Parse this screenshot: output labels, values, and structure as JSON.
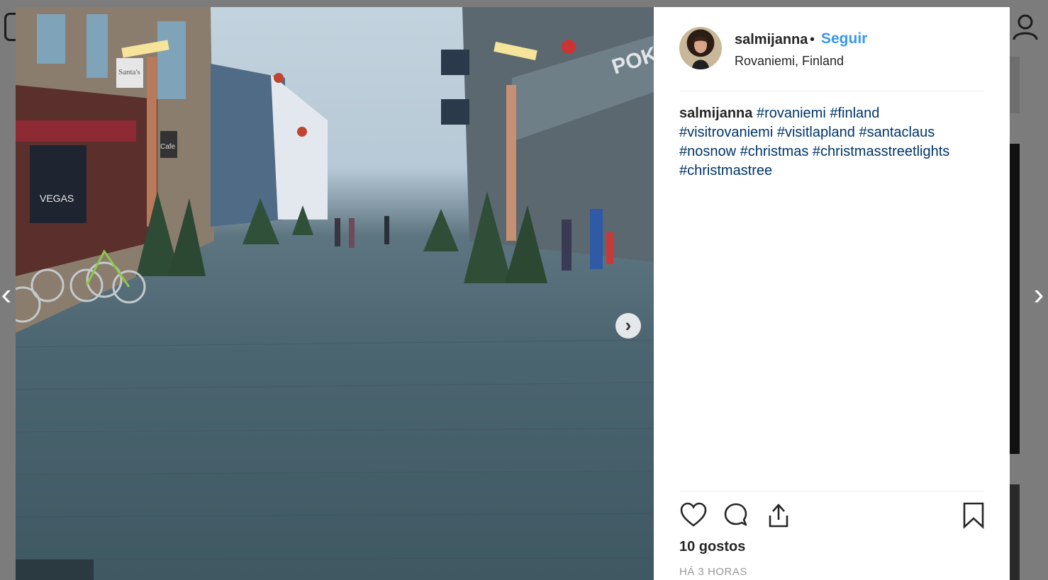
{
  "post": {
    "username": "salmijanna",
    "separator": "•",
    "follow_label": "Seguir",
    "location": "Rovaniemi, Finland",
    "caption_user": "salmijanna",
    "hashtags": [
      "#rovaniemi",
      "#finland",
      "#visitrovaniemi",
      "#visitlapland",
      "#santaclaus",
      "#nosnow",
      "#christmas",
      "#christmasstreetlights",
      "#christmastree"
    ],
    "likes": "10 gostos",
    "timestamp": "HÁ 3 HORAS"
  },
  "photo": {
    "signs": [
      "VEGAS",
      "Santa's",
      "Cafe",
      "POKO"
    ]
  },
  "navigation": {
    "prev_arrow": "‹",
    "next_arrow": "›",
    "carousel_next": "›"
  },
  "colors": {
    "link": "#3897f0",
    "hashtag": "#003569",
    "text": "#262626",
    "muted": "#999999",
    "overlay": "#7c7c7c"
  },
  "icons": [
    "heart-icon",
    "comment-icon",
    "share-icon",
    "bookmark-icon",
    "chevron-right-icon",
    "profile-icon",
    "instagram-logo-icon"
  ]
}
